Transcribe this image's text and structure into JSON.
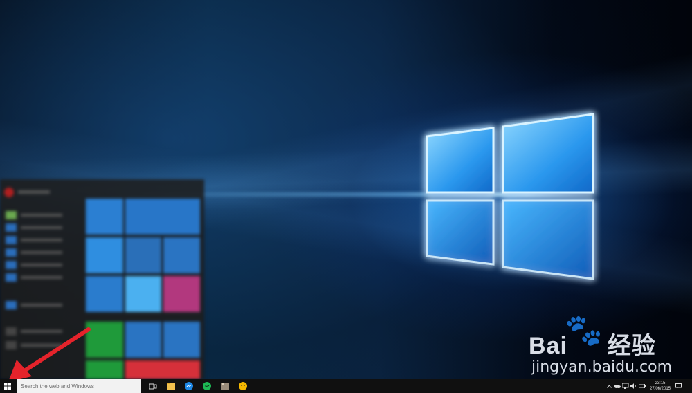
{
  "taskbar": {
    "search_placeholder": "Search the web and Windows",
    "pinned": [
      "task-view-icon",
      "file-explorer-icon",
      "messenger-icon",
      "spotify-icon",
      "media-icon",
      "emoji-icon"
    ],
    "tray": {
      "time": "23:15",
      "date": "27/06/2015"
    }
  },
  "watermark": {
    "brand": "Bai",
    "brand_cn": "经验",
    "url": "jingyan.baidu.com"
  },
  "colors": {
    "accent": "#0078d7",
    "taskbar": "#101010",
    "arrow": "#e5232b",
    "glow": "#6cc6ff"
  }
}
